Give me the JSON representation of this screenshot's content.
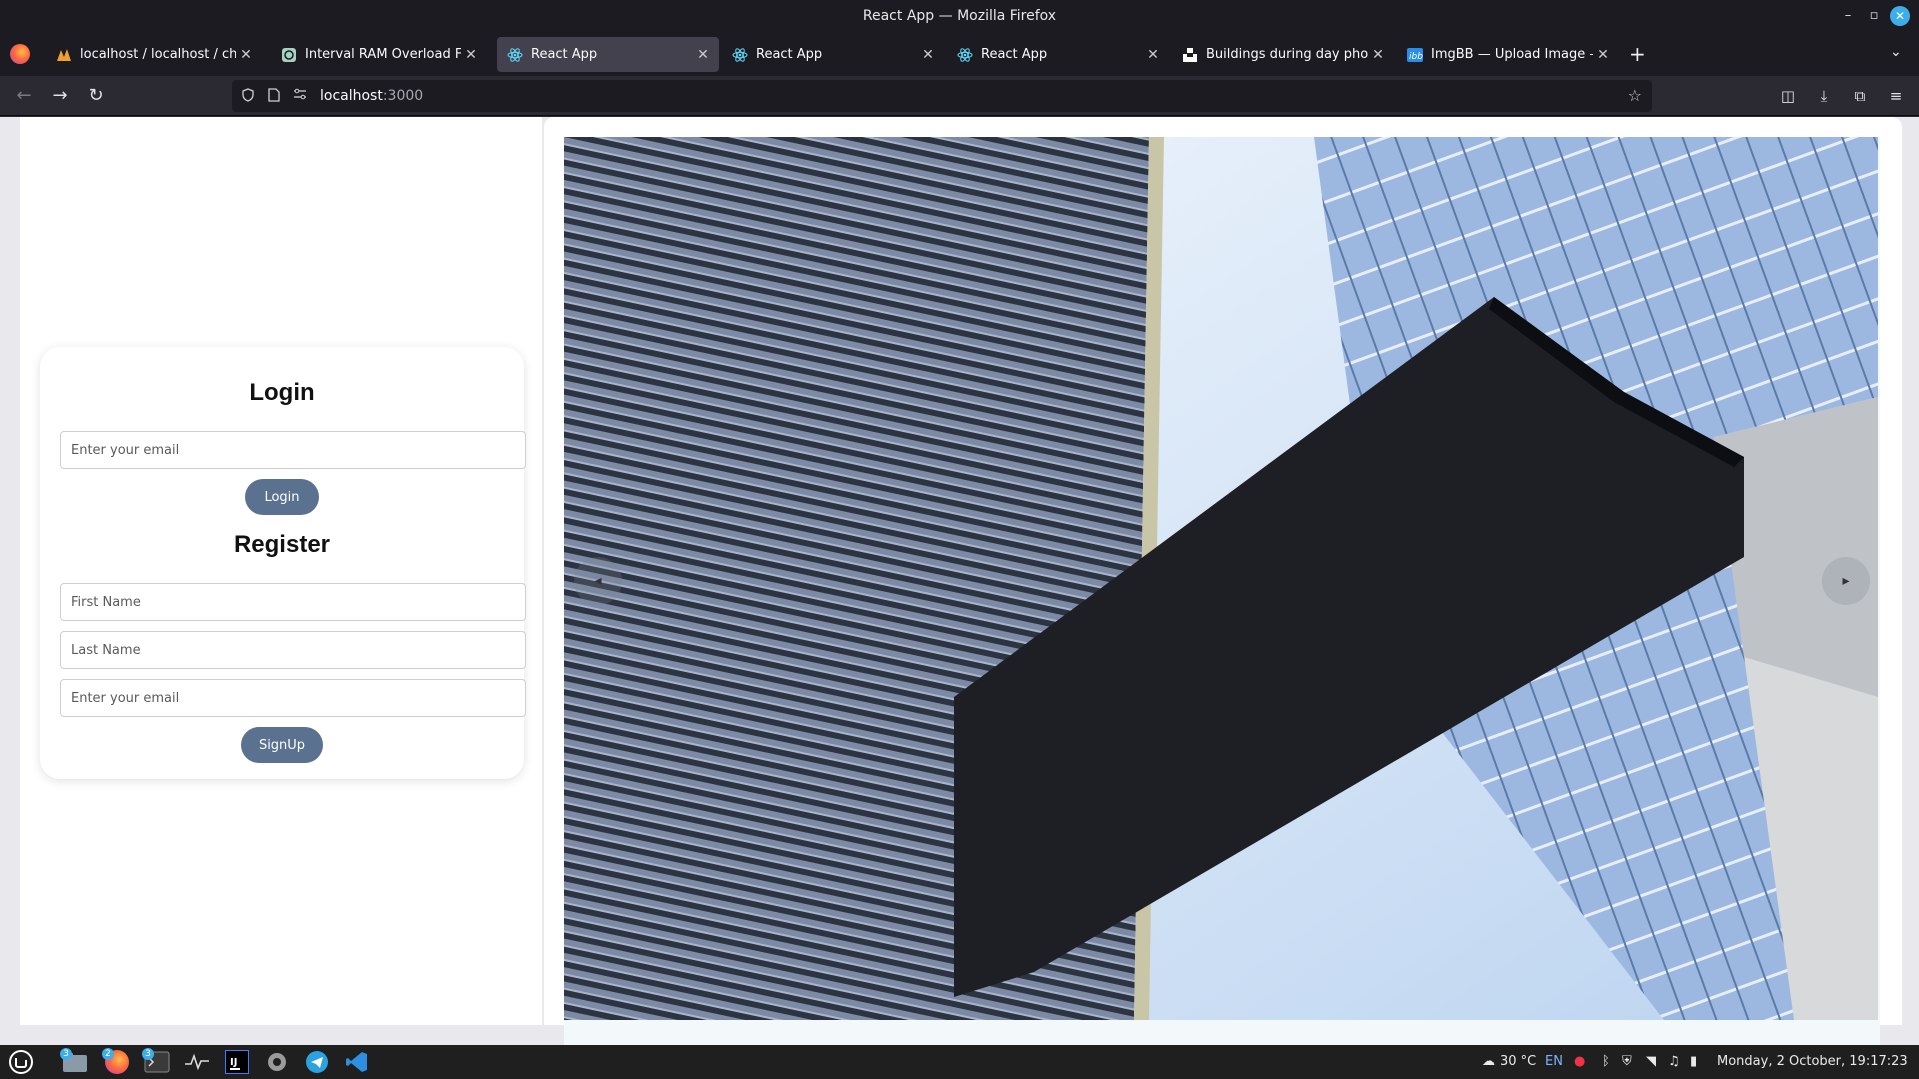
{
  "window": {
    "title": "React App — Mozilla Firefox",
    "min_glyph": "–",
    "max_glyph": "▫",
    "close_glyph": "✕"
  },
  "tabs": [
    {
      "label": "localhost / localhost / chatA",
      "icon": "phpmyadmin-icon",
      "active": false
    },
    {
      "label": "Interval RAM Overload Fix",
      "icon": "chatgpt-icon",
      "active": false
    },
    {
      "label": "React App",
      "icon": "react-icon",
      "active": true
    },
    {
      "label": "React App",
      "icon": "react-icon",
      "active": false
    },
    {
      "label": "React App",
      "icon": "react-icon",
      "active": false
    },
    {
      "label": "Buildings during day photo",
      "icon": "unsplash-icon",
      "active": false
    },
    {
      "label": "ImgBB — Upload Image — I",
      "icon": "imgbb-icon",
      "active": false
    }
  ],
  "tab_close_glyph": "✕",
  "newtab_glyph": "+",
  "tablist_glyph": "⌄",
  "nav": {
    "back": "←",
    "forward": "→",
    "reload": "↻",
    "url_host": "localhost",
    "url_port": ":3000",
    "star": "☆"
  },
  "toolbar_icons": [
    "pocket-icon",
    "download-icon",
    "extensions-icon",
    "menu-icon"
  ],
  "toolbar_glyphs": [
    "◫",
    "⤓",
    "⧉",
    "≡"
  ],
  "login": {
    "title": "Login",
    "email_placeholder": "Enter your email",
    "button": "Login"
  },
  "register": {
    "title": "Register",
    "first_name_placeholder": "First Name",
    "last_name_placeholder": "Last Name",
    "email_placeholder": "Enter your email",
    "button": "SignUp"
  },
  "carousel": {
    "prev_glyph": "◂",
    "next_glyph": "▸"
  },
  "taskbar": {
    "badges": {
      "files": "3",
      "firefox": "2",
      "terminal": "3"
    },
    "temperature": "30 °C",
    "language": "EN",
    "datetime": "Monday, 2 October, 19:17:23"
  }
}
